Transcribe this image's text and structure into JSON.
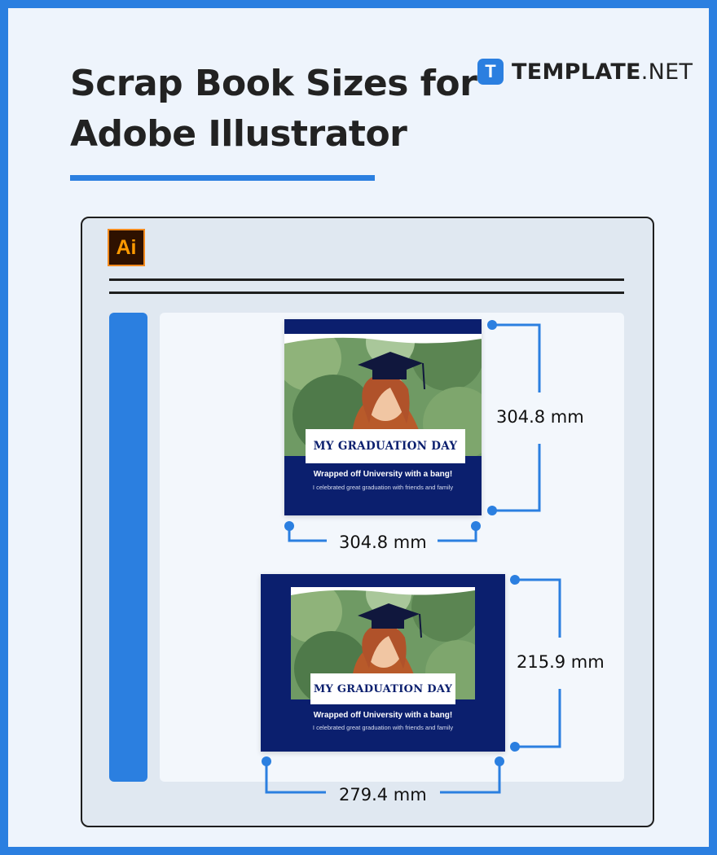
{
  "header": {
    "title_line1": "Scrap Book Sizes for",
    "title_line2": "Adobe Illustrator"
  },
  "brand": {
    "mark": "T",
    "name_bold": "TEMPLATE",
    "name_rest": ".NET"
  },
  "app_window": {
    "app_icon_label": "Ai"
  },
  "posters": [
    {
      "heading": "MY GRADUATION DAY",
      "tagline": "Wrapped off University with a bang!",
      "subline": "I celebrated great graduation with friends and family",
      "height_label": "304.8 mm",
      "width_label": "304.8 mm"
    },
    {
      "heading": "MY GRADUATION DAY",
      "tagline": "Wrapped off University with a bang!",
      "subline": "I celebrated great graduation with friends and family",
      "height_label": "215.9 mm",
      "width_label": "279.4 mm"
    }
  ],
  "colors": {
    "accent": "#2b7fe0",
    "frame_bg": "#eef4fc",
    "poster_navy": "#0b1f6e",
    "illustrator_orange": "#ff9a00"
  }
}
